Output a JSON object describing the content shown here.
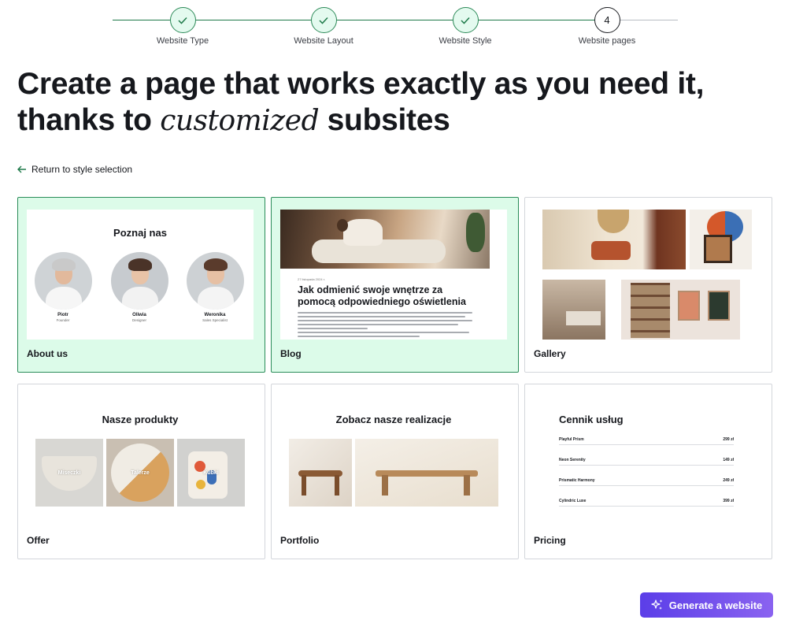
{
  "stepper": {
    "steps": [
      {
        "label": "Website Type",
        "status": "done"
      },
      {
        "label": "Website Layout",
        "status": "done"
      },
      {
        "label": "Website Style",
        "status": "done"
      },
      {
        "label": "Website pages",
        "status": "current",
        "number": "4"
      }
    ]
  },
  "headline": {
    "line1": "Create a page that works exactly as you need it,",
    "line2_before": "thanks to ",
    "line2_italic": "customized",
    "line2_after": " subsites"
  },
  "back_link": {
    "label": "Return to style selection"
  },
  "cards": {
    "about": {
      "label": "About us",
      "selected": true,
      "preview_title": "Poznaj nas",
      "members": [
        {
          "name": "Piotr",
          "role": "Founder"
        },
        {
          "name": "Oliwia",
          "role": "Designer"
        },
        {
          "name": "Weronika",
          "role": "Sales Specialist"
        }
      ]
    },
    "blog": {
      "label": "Blog",
      "selected": true,
      "preview_date": "27 listopada 2024 r.",
      "preview_title": "Jak odmienić swoje wnętrze za pomocą odpowiedniego oświetlenia"
    },
    "gallery": {
      "label": "Gallery",
      "selected": false
    },
    "offer": {
      "label": "Offer",
      "selected": false,
      "preview_title": "Nasze produkty",
      "items": [
        "Miseczki",
        "Talerze",
        "Kubki"
      ]
    },
    "portfolio": {
      "label": "Portfolio",
      "selected": false,
      "preview_title": "Zobacz nasze realizacje"
    },
    "pricing": {
      "label": "Pricing",
      "selected": false,
      "preview_title": "Cennik usług",
      "rows": [
        {
          "name": "Playful Prism",
          "price": "299 zł"
        },
        {
          "name": "Neon Serenity",
          "price": "149 zł"
        },
        {
          "name": "Prismatic Harmony",
          "price": "249 zł"
        },
        {
          "name": "Cylindric Luxe",
          "price": "399 zł"
        }
      ]
    }
  },
  "generate_button": {
    "label": "Generate a website",
    "icon": "sparkles-icon"
  },
  "colors": {
    "selected_bg": "#dcfbe9",
    "selected_border": "#2a8c59",
    "button_gradient_start": "#5b3ee8",
    "button_gradient_end": "#8a63f0"
  }
}
